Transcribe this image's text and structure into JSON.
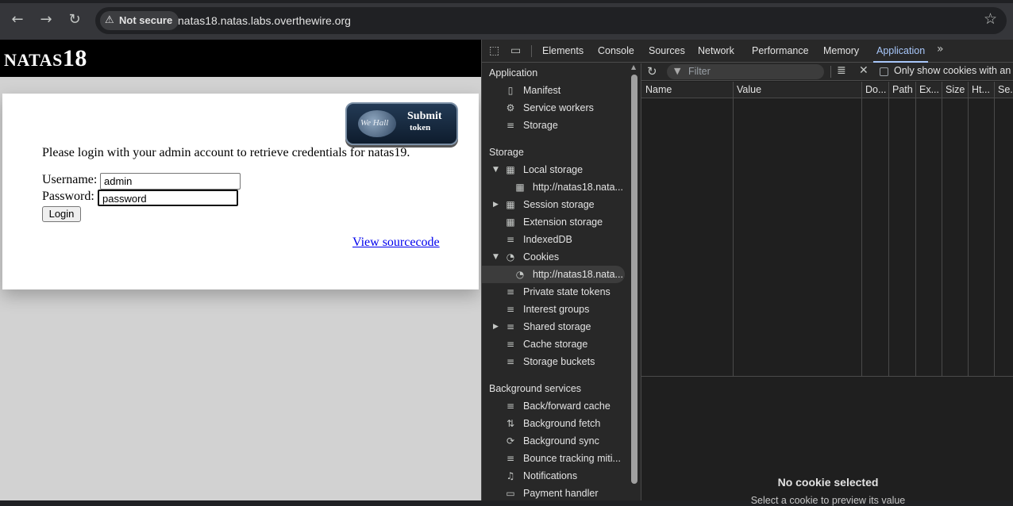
{
  "browser": {
    "security_label": "Not secure",
    "url": "natas18.natas.labs.overthewire.org"
  },
  "page": {
    "logo_main": "NATAS",
    "logo_number": "18",
    "token_line1": "Submit",
    "token_line2": "token",
    "token_globe_text": "We Hall",
    "instructions": "Please login with your admin account to retrieve credentials for natas19.",
    "username_label": "Username:",
    "username_value": "admin",
    "password_label": "Password:",
    "password_value": "password",
    "login_button": "Login",
    "view_source_link": "View sourcecode"
  },
  "devtools": {
    "tabs": [
      "Elements",
      "Console",
      "Sources",
      "Network",
      "Performance",
      "Memory",
      "Application"
    ],
    "active_tab": "Application",
    "sidebar": {
      "application_header": "Application",
      "application_items": [
        "Manifest",
        "Service workers",
        "Storage"
      ],
      "storage_header": "Storage",
      "storage_items": {
        "local_storage": "Local storage",
        "local_storage_child": "http://natas18.nata...",
        "session_storage": "Session storage",
        "extension_storage": "Extension storage",
        "indexeddb": "IndexedDB",
        "cookies": "Cookies",
        "cookies_child": "http://natas18.nata...",
        "private_state_tokens": "Private state tokens",
        "interest_groups": "Interest groups",
        "shared_storage": "Shared storage",
        "cache_storage": "Cache storage",
        "storage_buckets": "Storage buckets"
      },
      "background_header": "Background services",
      "background_items": [
        "Back/forward cache",
        "Background fetch",
        "Background sync",
        "Bounce tracking miti...",
        "Notifications",
        "Payment handler"
      ]
    },
    "toolbar": {
      "filter_placeholder": "Filter",
      "only_show_label": "Only show cookies with an is"
    },
    "columns": [
      "Name",
      "Value",
      "Do...",
      "Path",
      "Ex...",
      "Size",
      "Ht...",
      "Se..."
    ],
    "preview": {
      "title": "No cookie selected",
      "subtitle": "Select a cookie to preview its value"
    }
  }
}
